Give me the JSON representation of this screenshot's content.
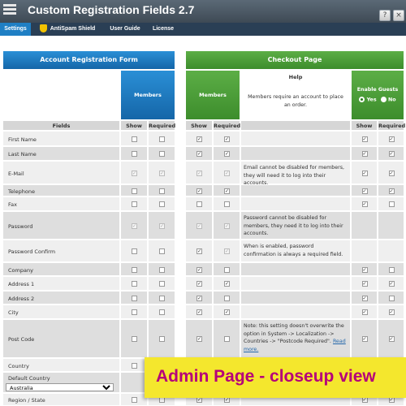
{
  "app": {
    "title": "Custom Registration Fields 2.7",
    "help_btn": "?",
    "close_btn": "×"
  },
  "tabs": [
    {
      "label": "Settings",
      "active": true
    },
    {
      "label": "AntiSpam Shield",
      "icon": "shield-icon"
    },
    {
      "label": "User Guide"
    },
    {
      "label": "License"
    }
  ],
  "account_form": {
    "title": "Account Registration Form",
    "members_header": "Members"
  },
  "checkout": {
    "title": "Checkout Page",
    "members_header": "Members",
    "help_title": "Help",
    "help_text": "Members require an account to place an order.",
    "guests_header": "Enable Guests",
    "yes_label": "Yes",
    "no_label": "No"
  },
  "columns": {
    "fields": "Fields",
    "show": "Show",
    "required": "Required"
  },
  "rows": [
    {
      "name": "First Name",
      "acc": [
        "u",
        "u"
      ],
      "mem": [
        "c",
        "c"
      ],
      "help": "",
      "guest": [
        "c",
        "c"
      ]
    },
    {
      "name": "Last Name",
      "acc": [
        "u",
        "u"
      ],
      "mem": [
        "c",
        "c"
      ],
      "help": "",
      "guest": [
        "c",
        "c"
      ]
    },
    {
      "name": "E-Mail",
      "acc": [
        "d",
        "d"
      ],
      "mem": [
        "d",
        "d"
      ],
      "help": "Email cannot be disabled for members, they will need it to log into their accounts.",
      "guest": [
        "c",
        "c"
      ]
    },
    {
      "name": "Telephone",
      "acc": [
        "u",
        "u"
      ],
      "mem": [
        "c",
        "c"
      ],
      "help": "",
      "guest": [
        "c",
        "c"
      ]
    },
    {
      "name": "Fax",
      "acc": [
        "u",
        "u"
      ],
      "mem": [
        "u",
        "u"
      ],
      "help": "",
      "guest": [
        "c",
        "u"
      ]
    },
    {
      "name": "Password",
      "acc": [
        "d",
        "d"
      ],
      "mem": [
        "d",
        "d"
      ],
      "help": "Password cannot be disabled for members, they need it to log into their accounts.",
      "guest": [
        "n",
        "n"
      ]
    },
    {
      "name": "Password Confirm",
      "acc": [
        "u",
        "u"
      ],
      "mem": [
        "c",
        "d"
      ],
      "help": "When is enabled, password confirmation is always a required field.",
      "guest": [
        "n",
        "n"
      ]
    },
    {
      "name": "Company",
      "acc": [
        "u",
        "u"
      ],
      "mem": [
        "c",
        "u"
      ],
      "help": "",
      "guest": [
        "c",
        "u"
      ]
    },
    {
      "name": "Address 1",
      "acc": [
        "u",
        "u"
      ],
      "mem": [
        "c",
        "c"
      ],
      "help": "",
      "guest": [
        "c",
        "c"
      ]
    },
    {
      "name": "Address 2",
      "acc": [
        "u",
        "u"
      ],
      "mem": [
        "c",
        "u"
      ],
      "help": "",
      "guest": [
        "c",
        "u"
      ]
    },
    {
      "name": "City",
      "acc": [
        "u",
        "u"
      ],
      "mem": [
        "c",
        "c"
      ],
      "help": "",
      "guest": [
        "c",
        "c"
      ]
    },
    {
      "name": "Post Code",
      "acc": [
        "u",
        "u"
      ],
      "mem": [
        "c",
        "u"
      ],
      "help": "Note: this setting doesn't overwrite the option in System -> Localization -> Countries -> \"Postcode Required\".",
      "help_link": "Read more.",
      "guest": [
        "c",
        "c"
      ]
    },
    {
      "name": "Country",
      "acc": [
        "u",
        "n"
      ],
      "mem": [
        "n",
        "n"
      ],
      "help": "",
      "guest": [
        "n",
        "n"
      ]
    },
    {
      "name": "Default Country",
      "select": "Australia",
      "acc": [
        "n",
        "n"
      ],
      "mem": [
        "n",
        "n"
      ],
      "help": "",
      "guest": [
        "n",
        "n"
      ]
    },
    {
      "name": "Region / State",
      "acc": [
        "u",
        "u"
      ],
      "mem": [
        "c",
        "c"
      ],
      "help": "",
      "guest": [
        "c",
        "c"
      ]
    }
  ],
  "banner": {
    "text": "Admin Page - closeup view"
  },
  "colors": {
    "blue": "#1f7fc4",
    "green": "#4c9e37",
    "banner": "#f4e72d",
    "banner_text": "#b5007a"
  }
}
